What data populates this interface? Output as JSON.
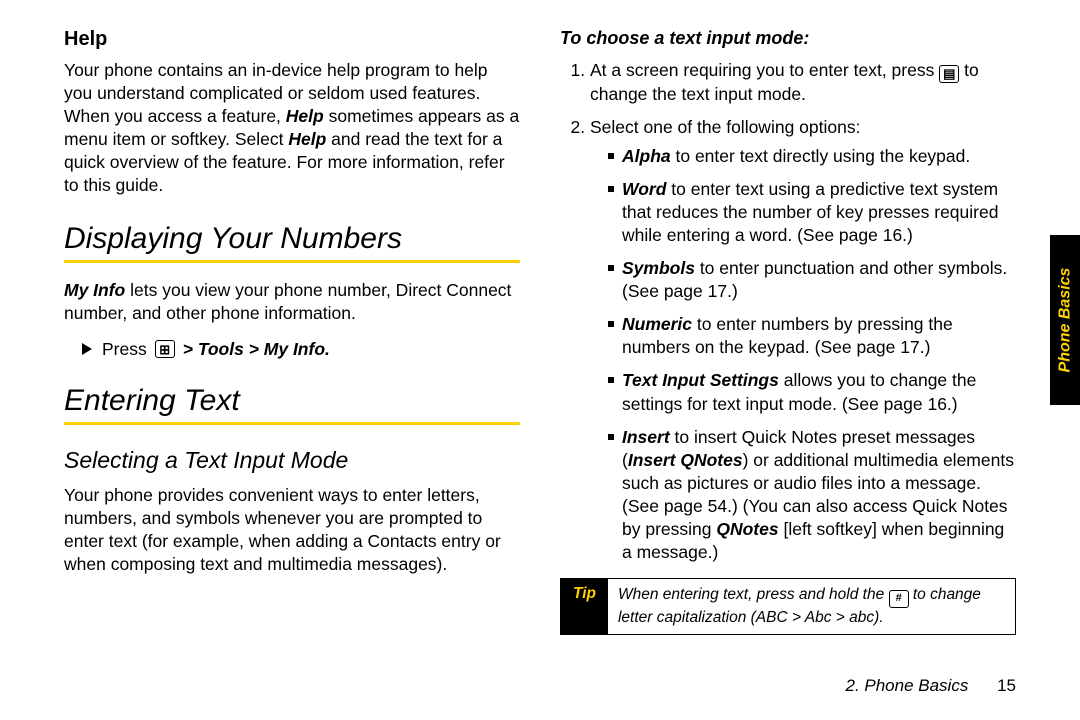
{
  "left": {
    "help_heading": "Help",
    "help_body_1": "Your phone contains an in-device help program to help you understand complicated or seldom used features. When you access a feature, ",
    "help_inline_1": "Help",
    "help_body_2": " sometimes appears as a menu item or softkey. Select ",
    "help_inline_2": "Help",
    "help_body_3": " and read the text for a quick overview of the feature. For more information, refer to this guide.",
    "displaying_heading": "Displaying Your Numbers",
    "myinfo_inline": "My Info",
    "myinfo_body": " lets you view your phone number, Direct Connect number, and other phone information.",
    "press_label": "Press",
    "press_path": "> Tools > My Info.",
    "entering_heading": "Entering Text",
    "selecting_heading": "Selecting a Text Input Mode",
    "selecting_body": "Your phone provides convenient ways to enter letters, numbers, and symbols whenever you are prompted to enter text (for example, when adding a Contacts entry or when composing text and multimedia messages)."
  },
  "right": {
    "choose_heading": "To choose a text input mode:",
    "step1_a": "At a screen requiring you to enter text, press ",
    "step1_b": " to change the text input mode.",
    "step2": "Select one of the following options:",
    "opts": {
      "alpha_name": "Alpha",
      "alpha_body": " to enter text directly using the keypad.",
      "word_name": "Word",
      "word_body": " to enter text using a predictive text system that reduces the number of key presses required while entering a word. (See page 16.)",
      "symbols_name": "Symbols",
      "symbols_body": " to enter punctuation and other symbols. (See page 17.)",
      "numeric_name": "Numeric",
      "numeric_body": " to enter numbers by pressing the numbers on the keypad. (See page 17.)",
      "tis_name": "Text Input Settings",
      "tis_body": " allows you to change the settings for text input mode. (See page 16.)",
      "insert_name": "Insert",
      "insert_body_a": " to insert Quick Notes preset messages (",
      "insert_qnotes": "Insert QNotes",
      "insert_body_b": ") or additional multimedia elements such as pictures or audio files into a message. (See page 54.) (You can also access Quick Notes by pressing ",
      "qnotes_key": "QNotes",
      "insert_body_c": " [left softkey] when beginning a message.)"
    },
    "tip_label": "Tip",
    "tip_a": "When entering text, press and hold the ",
    "tip_b": " to change letter capitalization (ABC > Abc > abc)."
  },
  "side_tab": "Phone Basics",
  "footer_section": "2. Phone Basics",
  "footer_page": "15"
}
